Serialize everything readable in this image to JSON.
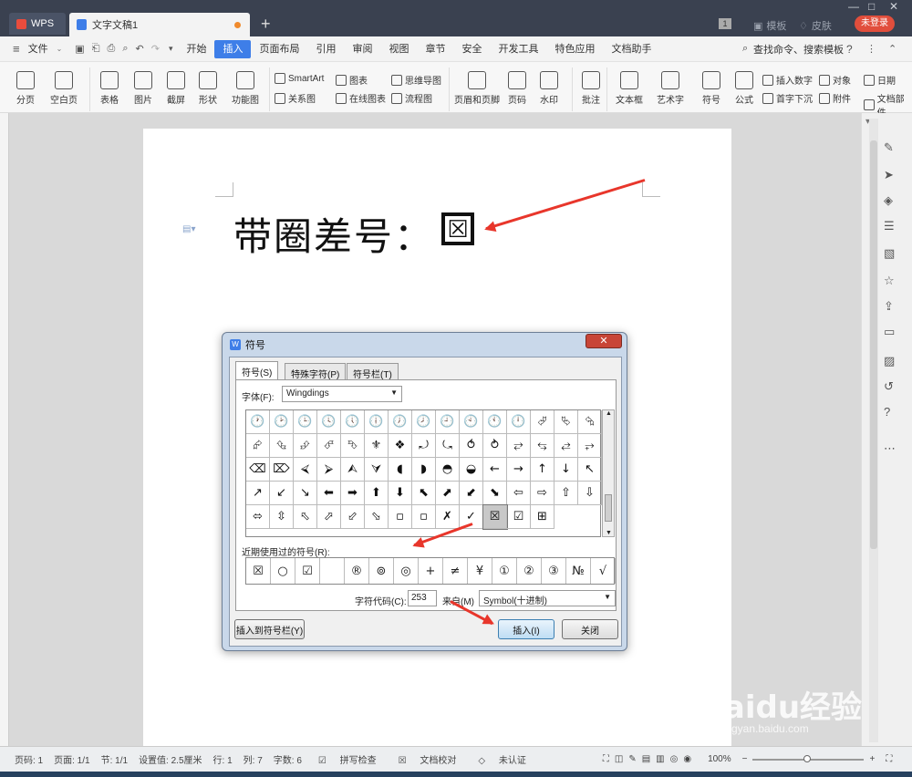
{
  "tabs": {
    "app": "WPS",
    "document": "文字文稿1",
    "new_tab": "+"
  },
  "titlebar": {
    "page_num": "1",
    "template": "模板",
    "skin": "皮肤",
    "login": "未登录"
  },
  "menubar": {
    "file": "文件",
    "items": [
      "开始",
      "插入",
      "页面布局",
      "引用",
      "审阅",
      "视图",
      "章节",
      "安全",
      "开发工具",
      "特色应用",
      "文档助手"
    ],
    "active_index": 1,
    "search": "查找命令、搜索模板",
    "help": "?"
  },
  "ribbon": {
    "big": [
      "分页",
      "空白页",
      "表格",
      "图片",
      "截屏",
      "形状",
      "功能图",
      "页眉和页脚",
      "页码",
      "水印",
      "批注",
      "文本框",
      "艺术字",
      "符号",
      "公式"
    ],
    "small": [
      "SmartArt",
      "图表",
      "思维导图",
      "关系图",
      "在线图表",
      "流程图",
      "插入数字",
      "对象",
      "日期",
      "首字下沉",
      "附件",
      "文档部件"
    ]
  },
  "document": {
    "title": "带圈差号：",
    "symbol": "☒"
  },
  "dialog": {
    "title": "符号",
    "close": "✕",
    "tabs": [
      "符号(S)",
      "特殊字符(P)",
      "符号栏(T)"
    ],
    "font_label": "字体(F):",
    "font_value": "Wingdings",
    "symbols": [
      "🕐",
      "🕑",
      "🕒",
      "🕓",
      "🕔",
      "🕕",
      "🕖",
      "🕗",
      "🕘",
      "🕙",
      "🕚",
      "🕛",
      "⮰",
      "⮱",
      "⮲",
      "⮳",
      "⮴",
      "⮵",
      "⮶",
      "⮷",
      "⚜",
      "❖",
      "⤾",
      "⤿",
      "⥀",
      "⥁",
      "⥂",
      "⥃",
      "⥄",
      "⥅",
      "⌫",
      "⌦",
      "⮘",
      "⮚",
      "⮙",
      "⮛",
      "◖",
      "◗",
      "◓",
      "◒",
      "←",
      "→",
      "↑",
      "↓",
      "↖",
      "↗",
      "↙",
      "↘",
      "⬅",
      "➡",
      "⬆",
      "⬇",
      "⬉",
      "⬈",
      "⬋",
      "⬊",
      "⇦",
      "⇨",
      "⇧",
      "⇩",
      "⬄",
      "⇳",
      "⬁",
      "⬀",
      "⬃",
      "⬂",
      "▫",
      "▫",
      "✗",
      "✓",
      "☒",
      "☑",
      "⊞"
    ],
    "selected_symbol_index": 70,
    "recent_label": "近期使用过的符号(R):",
    "recent": [
      "☒",
      "○",
      "☑",
      "",
      "®",
      "⊚",
      "◎",
      "+",
      "≠",
      "¥",
      "①",
      "②",
      "③",
      "№",
      "√"
    ],
    "code_label": "字符代码(C):",
    "code_value": "253",
    "from_label": "来自(M)",
    "from_value": "Symbol(十进制)",
    "insert_to_bar": "插入到符号栏(Y)",
    "insert": "插入(I)",
    "close_btn": "关闭"
  },
  "statusbar": {
    "page": "页码: 1",
    "pages": "页面: 1/1",
    "section": "节: 1/1",
    "setting": "设置值: 2.5厘米",
    "row": "行: 1",
    "col": "列: 7",
    "words": "字数: 6",
    "spell": "拼写检查",
    "proof": "文档校对",
    "cert": "未认证",
    "zoom": "100%"
  },
  "watermark": {
    "brand": "Baidu经验",
    "url": "jingyan.baidu.com"
  },
  "colors": {
    "accent": "#3e7ee8",
    "arrow": "#e8362b",
    "login": "#e14e3c"
  }
}
